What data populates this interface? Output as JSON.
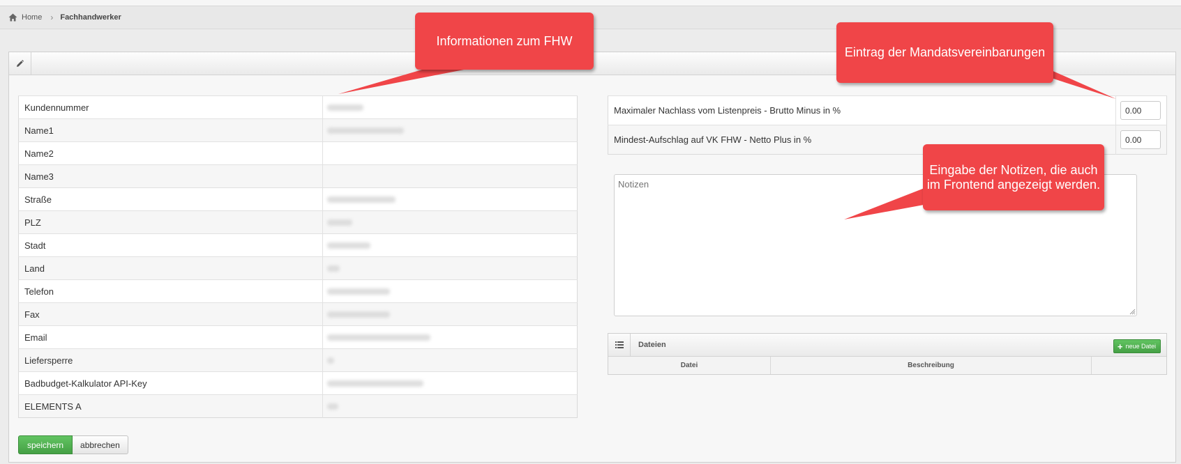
{
  "breadcrumb": {
    "home_label": "Home",
    "current_label": "Fachhandwerker"
  },
  "customer_info": {
    "rows": [
      {
        "label": "Kundennummer"
      },
      {
        "label": "Name1"
      },
      {
        "label": "Name2"
      },
      {
        "label": "Name3"
      },
      {
        "label": "Straße"
      },
      {
        "label": "PLZ"
      },
      {
        "label": "Stadt"
      },
      {
        "label": "Land"
      },
      {
        "label": "Telefon"
      },
      {
        "label": "Fax"
      },
      {
        "label": "Email"
      },
      {
        "label": "Liefersperre"
      },
      {
        "label": "Badbudget-Kalkulator API-Key"
      },
      {
        "label": "ELEMENTS A"
      }
    ]
  },
  "actions": {
    "save_label": "speichern",
    "cancel_label": "abbrechen"
  },
  "mandate": {
    "rows": [
      {
        "label": "Maximaler Nachlass vom Listenpreis - Brutto Minus in %",
        "value": "0.00"
      },
      {
        "label": "Mindest-Aufschlag auf VK FHW - Netto Plus in %",
        "value": "0.00"
      }
    ]
  },
  "notes": {
    "placeholder": "Notizen"
  },
  "files": {
    "title": "Dateien",
    "new_file_label": "neue Datei",
    "columns": [
      "Datei",
      "Beschreibung",
      ""
    ]
  },
  "callouts": {
    "info": "Informationen zum FHW",
    "mandate": "Eintrag der Mandatsvereinbarungen",
    "notes": "Eingabe der Notizen, die auch im Frontend angezeigt werden."
  },
  "colors": {
    "callout": "#f04548",
    "primary_button": "#4cae4c"
  },
  "icons": [
    "home-icon",
    "chevron-right-icon",
    "pencil-icon",
    "list-icon",
    "plus-icon"
  ]
}
